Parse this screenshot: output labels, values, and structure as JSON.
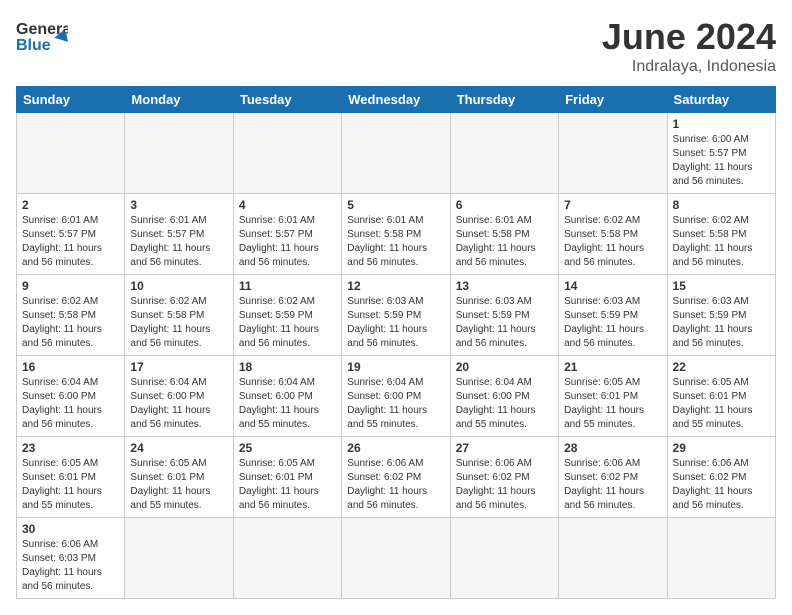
{
  "header": {
    "logo_general": "General",
    "logo_blue": "Blue",
    "month": "June 2024",
    "location": "Indralaya, Indonesia"
  },
  "weekdays": [
    "Sunday",
    "Monday",
    "Tuesday",
    "Wednesday",
    "Thursday",
    "Friday",
    "Saturday"
  ],
  "weeks": [
    [
      {
        "day": "",
        "info": ""
      },
      {
        "day": "",
        "info": ""
      },
      {
        "day": "",
        "info": ""
      },
      {
        "day": "",
        "info": ""
      },
      {
        "day": "",
        "info": ""
      },
      {
        "day": "",
        "info": ""
      },
      {
        "day": "1",
        "info": "Sunrise: 6:00 AM\nSunset: 5:57 PM\nDaylight: 11 hours\nand 56 minutes."
      }
    ],
    [
      {
        "day": "2",
        "info": "Sunrise: 6:01 AM\nSunset: 5:57 PM\nDaylight: 11 hours\nand 56 minutes."
      },
      {
        "day": "3",
        "info": "Sunrise: 6:01 AM\nSunset: 5:57 PM\nDaylight: 11 hours\nand 56 minutes."
      },
      {
        "day": "4",
        "info": "Sunrise: 6:01 AM\nSunset: 5:57 PM\nDaylight: 11 hours\nand 56 minutes."
      },
      {
        "day": "5",
        "info": "Sunrise: 6:01 AM\nSunset: 5:58 PM\nDaylight: 11 hours\nand 56 minutes."
      },
      {
        "day": "6",
        "info": "Sunrise: 6:01 AM\nSunset: 5:58 PM\nDaylight: 11 hours\nand 56 minutes."
      },
      {
        "day": "7",
        "info": "Sunrise: 6:02 AM\nSunset: 5:58 PM\nDaylight: 11 hours\nand 56 minutes."
      },
      {
        "day": "8",
        "info": "Sunrise: 6:02 AM\nSunset: 5:58 PM\nDaylight: 11 hours\nand 56 minutes."
      }
    ],
    [
      {
        "day": "9",
        "info": "Sunrise: 6:02 AM\nSunset: 5:58 PM\nDaylight: 11 hours\nand 56 minutes."
      },
      {
        "day": "10",
        "info": "Sunrise: 6:02 AM\nSunset: 5:58 PM\nDaylight: 11 hours\nand 56 minutes."
      },
      {
        "day": "11",
        "info": "Sunrise: 6:02 AM\nSunset: 5:59 PM\nDaylight: 11 hours\nand 56 minutes."
      },
      {
        "day": "12",
        "info": "Sunrise: 6:03 AM\nSunset: 5:59 PM\nDaylight: 11 hours\nand 56 minutes."
      },
      {
        "day": "13",
        "info": "Sunrise: 6:03 AM\nSunset: 5:59 PM\nDaylight: 11 hours\nand 56 minutes."
      },
      {
        "day": "14",
        "info": "Sunrise: 6:03 AM\nSunset: 5:59 PM\nDaylight: 11 hours\nand 56 minutes."
      },
      {
        "day": "15",
        "info": "Sunrise: 6:03 AM\nSunset: 5:59 PM\nDaylight: 11 hours\nand 56 minutes."
      }
    ],
    [
      {
        "day": "16",
        "info": "Sunrise: 6:04 AM\nSunset: 6:00 PM\nDaylight: 11 hours\nand 56 minutes."
      },
      {
        "day": "17",
        "info": "Sunrise: 6:04 AM\nSunset: 6:00 PM\nDaylight: 11 hours\nand 56 minutes."
      },
      {
        "day": "18",
        "info": "Sunrise: 6:04 AM\nSunset: 6:00 PM\nDaylight: 11 hours\nand 55 minutes."
      },
      {
        "day": "19",
        "info": "Sunrise: 6:04 AM\nSunset: 6:00 PM\nDaylight: 11 hours\nand 55 minutes."
      },
      {
        "day": "20",
        "info": "Sunrise: 6:04 AM\nSunset: 6:00 PM\nDaylight: 11 hours\nand 55 minutes."
      },
      {
        "day": "21",
        "info": "Sunrise: 6:05 AM\nSunset: 6:01 PM\nDaylight: 11 hours\nand 55 minutes."
      },
      {
        "day": "22",
        "info": "Sunrise: 6:05 AM\nSunset: 6:01 PM\nDaylight: 11 hours\nand 55 minutes."
      }
    ],
    [
      {
        "day": "23",
        "info": "Sunrise: 6:05 AM\nSunset: 6:01 PM\nDaylight: 11 hours\nand 55 minutes."
      },
      {
        "day": "24",
        "info": "Sunrise: 6:05 AM\nSunset: 6:01 PM\nDaylight: 11 hours\nand 55 minutes."
      },
      {
        "day": "25",
        "info": "Sunrise: 6:05 AM\nSunset: 6:01 PM\nDaylight: 11 hours\nand 56 minutes."
      },
      {
        "day": "26",
        "info": "Sunrise: 6:06 AM\nSunset: 6:02 PM\nDaylight: 11 hours\nand 56 minutes."
      },
      {
        "day": "27",
        "info": "Sunrise: 6:06 AM\nSunset: 6:02 PM\nDaylight: 11 hours\nand 56 minutes."
      },
      {
        "day": "28",
        "info": "Sunrise: 6:06 AM\nSunset: 6:02 PM\nDaylight: 11 hours\nand 56 minutes."
      },
      {
        "day": "29",
        "info": "Sunrise: 6:06 AM\nSunset: 6:02 PM\nDaylight: 11 hours\nand 56 minutes."
      }
    ],
    [
      {
        "day": "30",
        "info": "Sunrise: 6:06 AM\nSunset: 6:03 PM\nDaylight: 11 hours\nand 56 minutes."
      },
      {
        "day": "",
        "info": ""
      },
      {
        "day": "",
        "info": ""
      },
      {
        "day": "",
        "info": ""
      },
      {
        "day": "",
        "info": ""
      },
      {
        "day": "",
        "info": ""
      },
      {
        "day": "",
        "info": ""
      }
    ]
  ]
}
